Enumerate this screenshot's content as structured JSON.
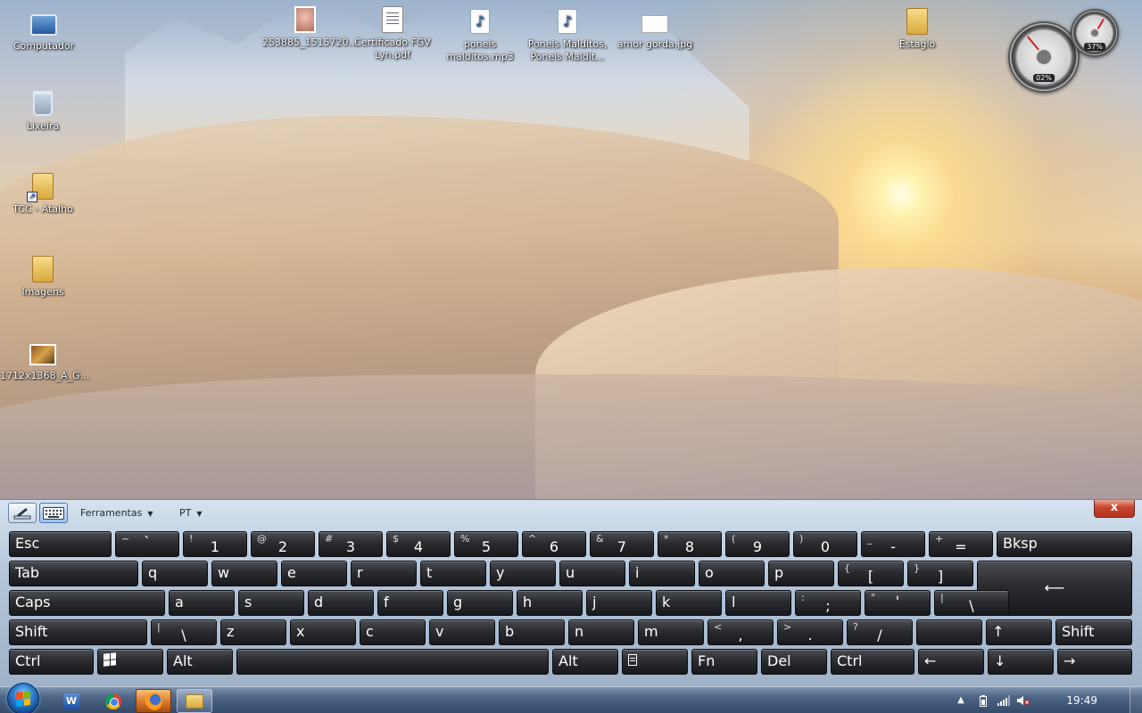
{
  "desktop": {
    "icons": [
      {
        "label": "Computador",
        "icon": "computer-icon"
      },
      {
        "label": "Lixeira",
        "icon": "recycle-bin-icon"
      },
      {
        "label": "TCC - Atalho",
        "icon": "folder-shortcut-icon"
      },
      {
        "label": "Imagens",
        "icon": "folder-icon"
      },
      {
        "label": "1712x1368_A_G...",
        "icon": "image-file-icon"
      },
      {
        "label": "253885_1515720...",
        "icon": "image-file-icon"
      },
      {
        "label": "Certificado FGV Lyn.pdf",
        "icon": "pdf-file-icon"
      },
      {
        "label": "poneis malditos.mp3",
        "icon": "mp3-file-icon"
      },
      {
        "label": "Poneis Malditos, Poneis Maldit...",
        "icon": "mp3-file-icon"
      },
      {
        "label": "amor gorda.jpg",
        "icon": "image-file-icon"
      },
      {
        "label": "Estagio",
        "icon": "folder-icon"
      }
    ],
    "gadget": {
      "cpu": "02%",
      "memory": "37%"
    }
  },
  "osk": {
    "toolbar": {
      "menu_tools": "Ferramentas",
      "menu_lang": "PT",
      "close": "x"
    },
    "keys": {
      "esc": "Esc",
      "tilde_sup": "~",
      "tilde_sub": "`",
      "k1_sup": "!",
      "k1": "1",
      "k2_sup": "@",
      "k2": "2",
      "k3_sup": "#",
      "k3": "3",
      "k4_sup": "$",
      "k4": "4",
      "k5_sup": "%",
      "k5": "5",
      "k6_sup": "^",
      "k6": "6",
      "k7_sup": "&",
      "k7": "7",
      "k8_sup": "*",
      "k8": "8",
      "k9_sup": "(",
      "k9": "9",
      "k0_sup": ")",
      "k0": "0",
      "minus_sup": "_",
      "minus": "-",
      "equals_sup": "+",
      "equals": "=",
      "bksp": "Bksp",
      "tab": "Tab",
      "q": "q",
      "w": "w",
      "e": "e",
      "r": "r",
      "t": "t",
      "y": "y",
      "u": "u",
      "i": "i",
      "o": "o",
      "p": "p",
      "lbracket_sup": "{",
      "lbracket": "[",
      "rbracket_sup": "}",
      "rbracket": "]",
      "enter": "⟵",
      "caps": "Caps",
      "a": "a",
      "s": "s",
      "d": "d",
      "f": "f",
      "g": "g",
      "h": "h",
      "j": "j",
      "k": "k",
      "l": "l",
      "semicolon_sup": ":",
      "semicolon": ";",
      "quote_sup": "\"",
      "quote": "'",
      "backslash_sup": "|",
      "backslash": "\\",
      "shift": "Shift",
      "z": "z",
      "x": "x",
      "c": "c",
      "v": "v",
      "b": "b",
      "n": "n",
      "m": "m",
      "comma_sup": "<",
      "comma": ",",
      "period_sup": ">",
      "period": ".",
      "slash_sup": "?",
      "slash": "/",
      "up": "↑",
      "ctrl": "Ctrl",
      "alt": "Alt",
      "fn": "Fn",
      "del": "Del",
      "left": "←",
      "down": "↓",
      "right": "→"
    }
  },
  "taskbar": {
    "apps": [
      "Microsoft Word",
      "Google Chrome",
      "Firefox",
      "Windows Explorer"
    ],
    "clock": "19:49",
    "tray": {
      "show_hidden": "▲"
    }
  }
}
